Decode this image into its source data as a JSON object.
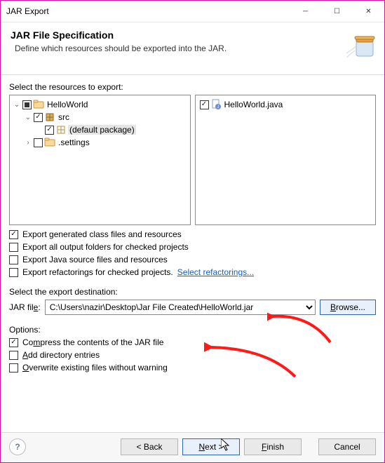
{
  "window": {
    "title": "JAR Export"
  },
  "header": {
    "title": "JAR File Specification",
    "subtitle": "Define which resources should be exported into the JAR."
  },
  "select_label": "Select the resources to export:",
  "tree": {
    "project": "HelloWorld",
    "src": "src",
    "default_pkg": "(default package)",
    "settings": ".settings"
  },
  "right_panel": {
    "file": "HelloWorld.java"
  },
  "options_group1": {
    "o1": "Export generated class files and resources",
    "o2": "Export all output folders for checked projects",
    "o3": "Export Java source files and resources",
    "o4": "Export refactorings for checked projects.",
    "o4_link": "Select refactorings..."
  },
  "dest": {
    "label": "Select the export destination:",
    "field_label": "JAR file:",
    "path": "C:\\Users\\nazir\\Desktop\\Jar File Created\\HelloWorld.jar",
    "browse": "Browse..."
  },
  "options2_label": "Options:",
  "options_group2": {
    "c1": "Compress the contents of the JAR file",
    "c2": "Add directory entries",
    "c3": "Overwrite existing files without warning"
  },
  "footer": {
    "back": "< Back",
    "next": "Next >",
    "finish": "Finish",
    "cancel": "Cancel"
  }
}
